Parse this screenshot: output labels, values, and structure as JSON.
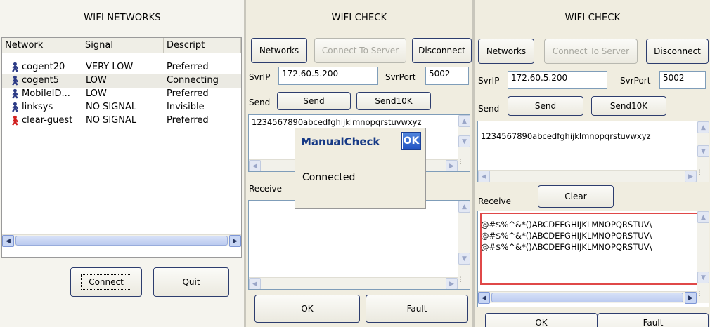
{
  "left": {
    "title": "WIFI NETWORKS",
    "columns": [
      "Network",
      "Signal",
      "Descript"
    ],
    "rows": [
      {
        "network": "cogent20",
        "signal": "VERY LOW",
        "desc": "Preferred",
        "icon": "wifi-person-icon"
      },
      {
        "network": "cogent5",
        "signal": "LOW",
        "desc": "Connecting",
        "icon": "wifi-person-icon"
      },
      {
        "network": "MobileID...",
        "signal": "LOW",
        "desc": "Preferred",
        "icon": "wifi-person-icon"
      },
      {
        "network": "linksys",
        "signal": "NO SIGNAL",
        "desc": "Invisible",
        "icon": "wifi-person-icon"
      },
      {
        "network": "clear-guest",
        "signal": "NO SIGNAL",
        "desc": "Preferred",
        "icon": "wifi-person-red-icon"
      }
    ],
    "connect_label": "Connect",
    "quit_label": "Quit"
  },
  "mid": {
    "title": "WIFI CHECK",
    "networks_label": "Networks",
    "connect_server_label": "Connect To Server",
    "disconnect_label": "Disconnect",
    "svrip_label": "SvrIP",
    "svrip_value": "172.60.5.200",
    "svrport_label": "SvrPort",
    "svrport_value": "5002",
    "send_label": "Send",
    "send_btn": "Send",
    "send10k_btn": "Send10K",
    "send_text": "1234567890abcedfghijklmnopqrstuvwxyz",
    "receive_label": "Receive",
    "ok_label": "OK",
    "fault_label": "Fault"
  },
  "dialog": {
    "title": "ManualCheck",
    "ok": "OK",
    "message": "Connected"
  },
  "right": {
    "title": "WIFI CHECK",
    "networks_label": "Networks",
    "connect_server_label": "Connect To Server",
    "disconnect_label": "Disconnect",
    "svrip_label": "SvrIP",
    "svrip_value": "172.60.5.200",
    "svrport_label": "SvrPort",
    "svrport_value": "5002",
    "send_label": "Send",
    "send_btn": "Send",
    "send10k_btn": "Send10K",
    "send_text": "1234567890abcedfghijklmnopqrstuvwxyz",
    "receive_label": "Receive",
    "clear_label": "Clear",
    "receive_lines": [
      "@#$%^&*()ABCDEFGHIJKLMNOPQRSTUV\\",
      "@#$%^&*()ABCDEFGHIJKLMNOPQRSTUV\\",
      "@#$%^&*()ABCDEFGHIJKLMNOPQRSTUV\\"
    ],
    "ok_label": "OK",
    "fault_label": "Fault"
  },
  "colors": {
    "panel_bg": "#f0ede0",
    "button_border": "#2d3d6e",
    "highlight_red": "#e04848",
    "dialog_ok_blue": "#2456c4"
  }
}
